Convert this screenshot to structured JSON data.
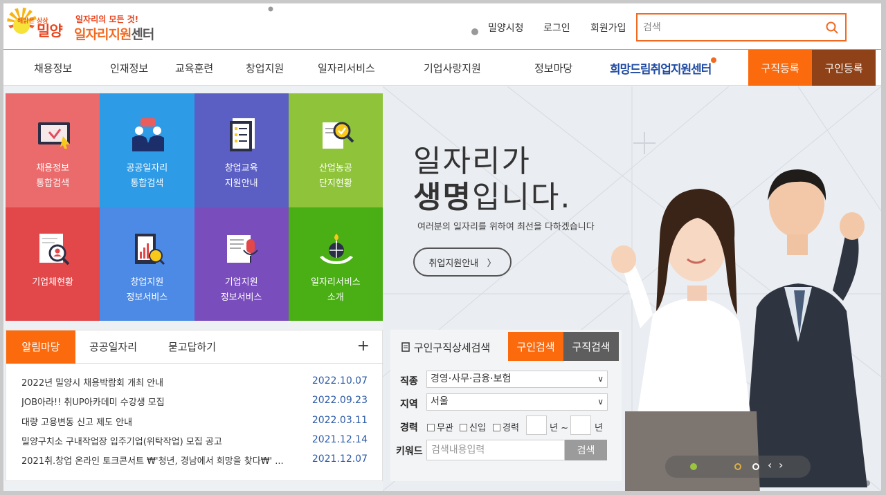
{
  "header": {
    "logo": {
      "brand_small": "해맑은 상상",
      "city": "밀양",
      "slogan": "일자리의 모든 것!",
      "center_name_orange": "일자리지원",
      "center_name_dark": "센터"
    },
    "links": {
      "city_hall": "밀양시청",
      "login": "로그인",
      "signup": "회원가입"
    },
    "search": {
      "placeholder": "검색"
    }
  },
  "nav": {
    "items": [
      "채용정보",
      "인재정보",
      "교육훈련",
      "창업지원",
      "일자리서비스",
      "기업사랑지원",
      "정보마당"
    ],
    "hope_center": "희망드림취업지원센터",
    "job_seek_register": "구직등록",
    "recruit_register": "구인등록"
  },
  "tiles": [
    {
      "label": [
        "채용정보",
        "통합검색"
      ],
      "color": "#eb6b6c",
      "icon": "monitor-cursor-icon"
    },
    {
      "label": [
        "공공일자리",
        "통합검색"
      ],
      "color": "#2e9be6",
      "icon": "people-chat-icon"
    },
    {
      "label": [
        "창업교육",
        "지원안내"
      ],
      "color": "#5b5fc4",
      "icon": "document-list-icon"
    },
    {
      "label": [
        "산업농공",
        "단지현황"
      ],
      "color": "#8ec33a",
      "icon": "document-magnifier-icon"
    },
    {
      "label": [
        "기업체현황"
      ],
      "color": "#e2474a",
      "icon": "person-search-icon"
    },
    {
      "label": [
        "창업지원",
        "정보서비스"
      ],
      "color": "#4c8ae6",
      "icon": "chart-coin-icon"
    },
    {
      "label": [
        "기업지원",
        "정보서비스"
      ],
      "color": "#7a4dbd",
      "icon": "document-mic-icon"
    },
    {
      "label": [
        "일자리서비스",
        "소개"
      ],
      "color": "#4aae15",
      "icon": "globe-hands-icon"
    }
  ],
  "hero": {
    "title_line1": "일자리가",
    "title_line2_bold": "생명",
    "title_line2_rest": "입니다.",
    "subtitle": "여러분의 일자리를 위하여 최선을 다하겠습니다",
    "button": "취업지원안내",
    "button_arrow": "〉"
  },
  "notice": {
    "tabs": [
      "알림마당",
      "공공일자리",
      "묻고답하기"
    ],
    "plus": "+",
    "rows": [
      {
        "title": "2022년 밀양시 채용박람회 개최 안내",
        "date": "2022.10.07"
      },
      {
        "title": "JOB아라!! 취UP아카데미 수강생 모집",
        "date": "2022.09.23"
      },
      {
        "title": "대량 고용변동 신고 제도 안내",
        "date": "2022.03.11"
      },
      {
        "title": "밀양구치소 구내작업장 입주기업(위탁작업) 모집 공고",
        "date": "2021.12.14"
      },
      {
        "title": "2021취.창업 온라인 토크콘서트 ₩'청년, 경남에서 희망을 찾다₩' ...",
        "date": "2021.12.07"
      }
    ]
  },
  "search_panel": {
    "title": "구인구직상세검색",
    "tab_recruit": "구인검색",
    "tab_jobseek": "구직검색",
    "job_label": "직종",
    "job_value": "경영·사무·금융·보험",
    "region_label": "지역",
    "region_value": "서울",
    "career_label": "경력",
    "career_options": [
      "무관",
      "신입",
      "경력"
    ],
    "year_unit": "년 ~",
    "year_unit2": "년",
    "keyword_label": "키워드",
    "keyword_placeholder": "검색내용입력",
    "search_button": "검색"
  }
}
